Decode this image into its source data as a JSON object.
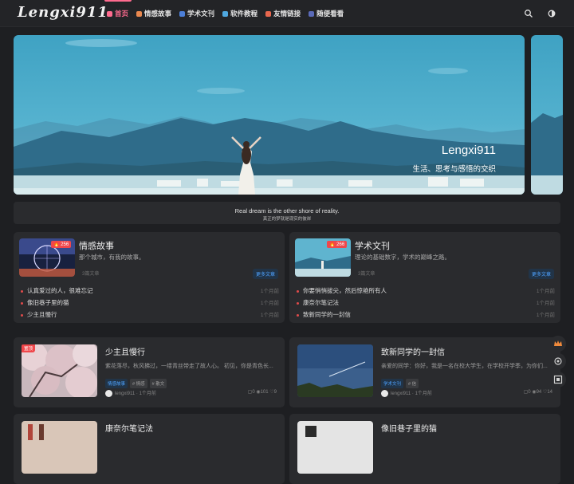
{
  "site": {
    "logo": "Lengxi911"
  },
  "nav": {
    "items": [
      {
        "label": "首页",
        "icon": "home-icon",
        "active": true
      },
      {
        "label": "情感故事",
        "icon": "heart-icon"
      },
      {
        "label": "学术文刊",
        "icon": "chart-icon"
      },
      {
        "label": "软件教程",
        "icon": "code-icon"
      },
      {
        "label": "友情链接",
        "icon": "link-icon"
      },
      {
        "label": "随便看看",
        "icon": "shuffle-icon"
      }
    ],
    "actions": [
      "search-icon",
      "theme-toggle-icon"
    ]
  },
  "hero": {
    "title": "Lengxi911",
    "subtitle": "生活、思考与感悟的交织"
  },
  "notice": {
    "line1": "Real dream is the other shore of reality.",
    "line2": "真正的梦就是现实的彼岸"
  },
  "categories": [
    {
      "title": "情感故事",
      "desc": "那个城市，有我的故事。",
      "badge": "256",
      "count": "3篇文章",
      "more": "更多文章",
      "posts": [
        {
          "title": "认真爱过的人，很难忘记",
          "time": "1个月前"
        },
        {
          "title": "像旧巷子里的猫",
          "time": "1个月前"
        },
        {
          "title": "少主且慢行",
          "time": "1个月前"
        }
      ]
    },
    {
      "title": "学术文刊",
      "desc": "理论的基础数字，学术的巅峰之路。",
      "badge": "266",
      "count": "3篇文章",
      "more": "更多文章",
      "posts": [
        {
          "title": "你要悄悄拔尖，然后惊艳所有人",
          "time": "1个月前"
        },
        {
          "title": "康奈尔笔记法",
          "time": "1个月前"
        },
        {
          "title": "致新同学的一封信",
          "time": "1个月前"
        }
      ]
    }
  ],
  "posts": [
    {
      "title": "少主且慢行",
      "excerpt": "紫花落尽，秋风拂过，一缕青丝带走了故人心。 初见，你是青色长...",
      "badge": "置顶",
      "tags": [
        "情感故事",
        "情感",
        "散文"
      ],
      "author": "lengxi911",
      "time": "1个月前",
      "comments": "0",
      "views": "101",
      "likes": "9"
    },
    {
      "title": "致新同学的一封信",
      "excerpt": "亲爱的同学：你好，我是一名在校大学生，在学校开学季，为你们...",
      "tags": [
        "学术文刊",
        "信"
      ],
      "author": "lengxi911",
      "time": "1个月前",
      "comments": "0",
      "views": "94",
      "likes": "14"
    },
    {
      "title": "康奈尔笔记法"
    },
    {
      "title": "像旧巷子里的猫"
    }
  ],
  "sidebar_tools": [
    "crown-icon",
    "settings-icon",
    "qrcode-icon"
  ],
  "colors": {
    "accent": "#ff6b8f",
    "background": "#1e1f22",
    "card": "#2a2b2e",
    "badge": "#f0474b",
    "link": "#4ea3ff"
  }
}
